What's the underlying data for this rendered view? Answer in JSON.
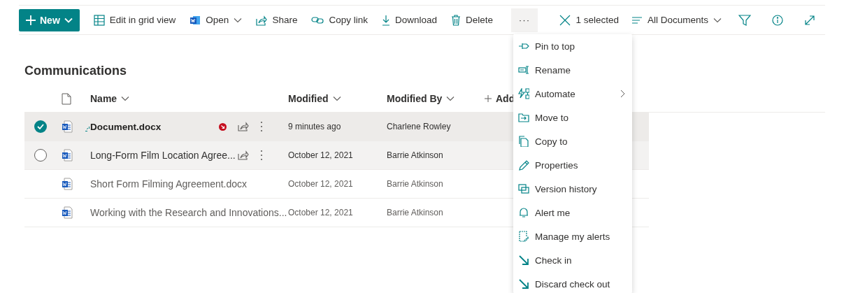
{
  "toolbar": {
    "commands": [
      {
        "kind": "new",
        "label": "New",
        "dropdown": true
      },
      {
        "kind": "grid",
        "label": "Edit in grid view",
        "dropdown": false
      },
      {
        "kind": "open",
        "label": "Open",
        "dropdown": true
      },
      {
        "kind": "share",
        "label": "Share",
        "dropdown": false
      },
      {
        "kind": "link",
        "label": "Copy link",
        "dropdown": false
      },
      {
        "kind": "download",
        "label": "Download",
        "dropdown": false
      },
      {
        "kind": "delete",
        "label": "Delete",
        "dropdown": false
      },
      {
        "kind": "more",
        "label": "···",
        "dropdown": false,
        "active": true
      }
    ],
    "right": [
      {
        "kind": "clear",
        "label": "1 selected",
        "dropdown": false
      },
      {
        "kind": "view",
        "label": "All Documents",
        "dropdown": true
      },
      {
        "kind": "filter"
      },
      {
        "kind": "info"
      },
      {
        "kind": "expand"
      }
    ]
  },
  "library": {
    "title": "Communications",
    "columns": [
      {
        "kind": "type"
      },
      {
        "kind": "text",
        "label": "Name",
        "sortable": true
      },
      {
        "kind": "text",
        "label": "Modified",
        "sortable": true
      },
      {
        "kind": "text",
        "label": "Modified By",
        "sortable": true
      },
      {
        "kind": "add",
        "label": "Add"
      }
    ],
    "rows": [
      {
        "name": "Document.docx",
        "modified": "9 minutes ago",
        "modified_by": "Charlene Rowley",
        "selected": true,
        "hovered": false,
        "recent": true,
        "checked_out": true,
        "actions": true
      },
      {
        "name": "Long-Form Film Location Agree...",
        "modified": "October 12, 2021",
        "modified_by": "Barrie Atkinson",
        "selected": false,
        "hovered": true,
        "recent": false,
        "checked_out": false,
        "actions": true
      },
      {
        "name": "Short Form Filming Agreement.docx",
        "modified": "October 12, 2021",
        "modified_by": "Barrie Atkinson",
        "selected": false,
        "hovered": false,
        "recent": false,
        "checked_out": false,
        "actions": false
      },
      {
        "name": "Working with the Research and Innovations...",
        "modified": "October 12, 2021",
        "modified_by": "Barrie Atkinson",
        "selected": false,
        "hovered": false,
        "recent": false,
        "checked_out": false,
        "actions": false
      }
    ]
  },
  "menu": {
    "items": [
      {
        "kind": "pin",
        "label": "Pin to top",
        "submenu": false
      },
      {
        "kind": "rename",
        "label": "Rename",
        "submenu": false
      },
      {
        "kind": "automate",
        "label": "Automate",
        "submenu": true
      },
      {
        "kind": "move",
        "label": "Move to",
        "submenu": false
      },
      {
        "kind": "copy",
        "label": "Copy to",
        "submenu": false
      },
      {
        "kind": "properties",
        "label": "Properties",
        "submenu": false
      },
      {
        "kind": "versions",
        "label": "Version history",
        "submenu": false
      },
      {
        "kind": "alert",
        "label": "Alert me",
        "submenu": false
      },
      {
        "kind": "alerts",
        "label": "Manage my alerts",
        "submenu": false
      },
      {
        "kind": "checkin",
        "label": "Check in",
        "submenu": false
      },
      {
        "kind": "discard",
        "label": "Discard check out",
        "submenu": false
      }
    ]
  }
}
